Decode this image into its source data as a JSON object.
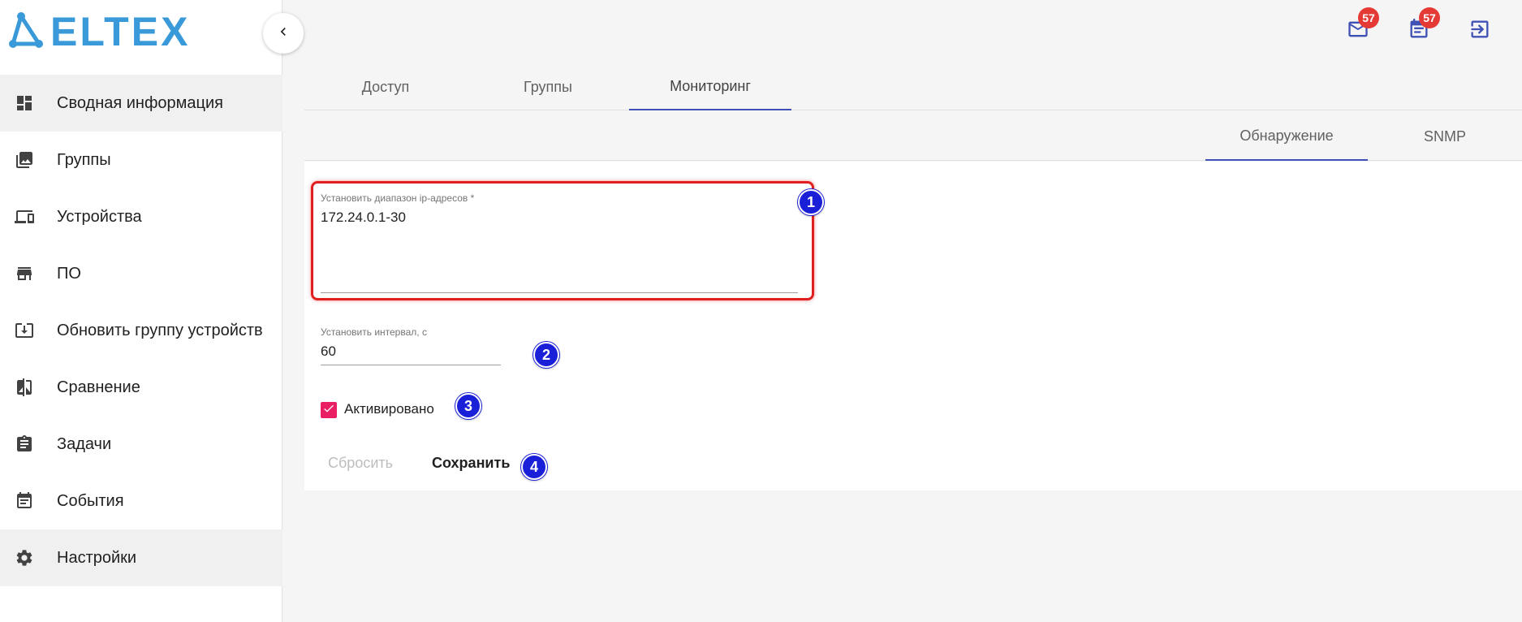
{
  "brand": {
    "logo_text": "ELTEX",
    "color": "#3a9ad9"
  },
  "sidebar": {
    "items": [
      {
        "label": "Сводная информация",
        "icon": "dashboard-icon",
        "active": true
      },
      {
        "label": "Группы",
        "icon": "photo-library-icon",
        "active": false
      },
      {
        "label": "Устройства",
        "icon": "devices-icon",
        "active": false
      },
      {
        "label": "ПО",
        "icon": "store-icon",
        "active": false
      },
      {
        "label": "Обновить группу устройств",
        "icon": "system-update-icon",
        "active": false
      },
      {
        "label": "Сравнение",
        "icon": "compare-icon",
        "active": false
      },
      {
        "label": "Задачи",
        "icon": "assignment-icon",
        "active": false
      },
      {
        "label": "События",
        "icon": "event-note-icon",
        "active": false
      },
      {
        "label": "Настройки",
        "icon": "gear-icon",
        "active": true
      }
    ]
  },
  "topbar": {
    "mail_badge": "57",
    "events_badge": "57"
  },
  "tabs": [
    {
      "label": "Доступ"
    },
    {
      "label": "Группы"
    },
    {
      "label": "Мониторинг",
      "active": true
    }
  ],
  "subtabs": [
    {
      "label": "Обнаружение",
      "active": true
    },
    {
      "label": "SNMP"
    }
  ],
  "form": {
    "ip_range": {
      "label": "Установить диапазон ip-адресов *",
      "value": "172.24.0.1-30"
    },
    "interval": {
      "label": "Установить интервал, с",
      "value": "60"
    },
    "activated": {
      "label": "Активировано",
      "checked": true
    },
    "reset_label": "Сбросить",
    "save_label": "Сохранить"
  },
  "markers": [
    "1",
    "2",
    "3",
    "4"
  ],
  "colors": {
    "accent": "#3f51b5",
    "checkbox": "#e91e63",
    "badge": "#e53935",
    "marker": "#1a1fd8",
    "highlight": "#e02020"
  }
}
